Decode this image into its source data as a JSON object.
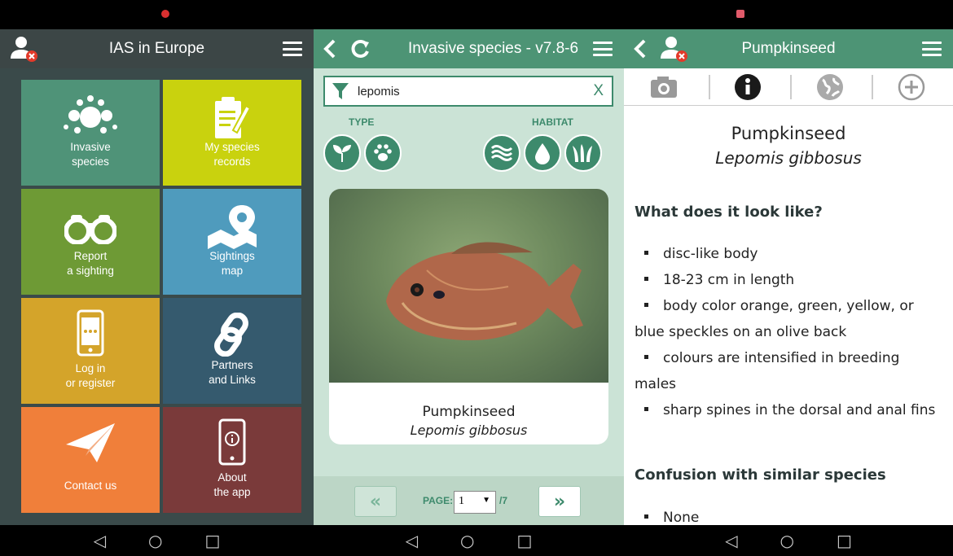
{
  "screen1": {
    "title": "IAS in Europe",
    "tiles": [
      {
        "label_line1": "Invasive",
        "label_line2": "species",
        "icon": "dots-cluster-icon",
        "color": "#4f9378"
      },
      {
        "label_line1": "My species",
        "label_line2": "records",
        "icon": "clipboard-pencil-icon",
        "color": "#c9d20e"
      },
      {
        "label_line1": "Report",
        "label_line2": "a sighting",
        "icon": "binoculars-icon",
        "color": "#6e9a35"
      },
      {
        "label_line1": "Sightings",
        "label_line2": "map",
        "icon": "map-pin-icon",
        "color": "#4f9bbd"
      },
      {
        "label_line1": "Log in",
        "label_line2": "or register",
        "icon": "phone-icon",
        "color": "#d4a42a"
      },
      {
        "label_line1": "Partners",
        "label_line2": "and Links",
        "icon": "link-icon",
        "color": "#355a6e"
      },
      {
        "label_line1": "Contact us",
        "label_line2": "",
        "icon": "paper-plane-icon",
        "color": "#f07f3a"
      },
      {
        "label_line1": "About",
        "label_line2": "the app",
        "icon": "phone-info-icon",
        "color": "#7a3a3a"
      }
    ]
  },
  "screen2": {
    "title": "Invasive species - v7.8-6",
    "search_value": "lepomis",
    "clear_label": "X",
    "type_label": "TYPE",
    "habitat_label": "HABITAT",
    "type_filters": [
      "plant-icon",
      "paw-icon"
    ],
    "habitat_filters": [
      "waves-icon",
      "water-drop-icon",
      "grass-icon"
    ],
    "card": {
      "common_name": "Pumpkinseed",
      "scientific_name": "Lepomis gibbosus"
    },
    "pager": {
      "label": "PAGE:",
      "current": "1",
      "total": "/7",
      "prev": "«",
      "next": "»"
    }
  },
  "screen3": {
    "title": "Pumpkinseed",
    "tabs": [
      "camera-icon",
      "info-icon",
      "globe-icon",
      "plus-circle-icon"
    ],
    "common_name": "Pumpkinseed",
    "scientific_name": "Lepomis gibbosus",
    "section1_heading": "What does it look like?",
    "section1_items": [
      "disc-like body",
      "18-23 cm in length",
      "body color orange, green, yellow, or blue speckles on an olive back",
      "colours are intensified in breeding males",
      "sharp spines in the dorsal and anal fins"
    ],
    "section2_heading": "Confusion with similar species",
    "section2_items": [
      "None"
    ]
  },
  "colors": {
    "green_bar": "#4d9475",
    "dark_bar": "#3c4646",
    "accent": "#3d8a6c",
    "pager_bg": "#bcd6c6"
  }
}
